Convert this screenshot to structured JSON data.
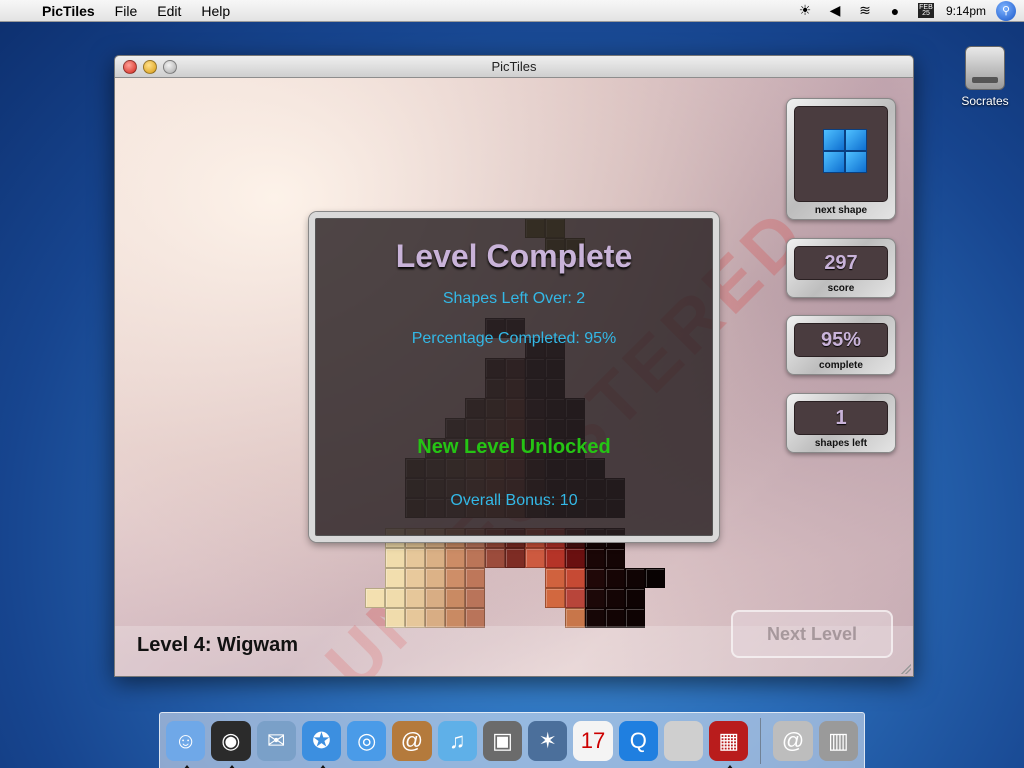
{
  "menubar": {
    "app_name": "PicTiles",
    "menus": [
      "File",
      "Edit",
      "Help"
    ],
    "calendar_month": "FEB",
    "calendar_day": "25",
    "clock": "9:14pm"
  },
  "desktop": {
    "drive_label": "Socrates"
  },
  "window": {
    "title": "PicTiles"
  },
  "dialog": {
    "title": "Level Complete",
    "shapes_left_over": "Shapes Left Over: 2",
    "percentage_completed": "Percentage Completed: 95%",
    "unlocked": "New Level Unlocked",
    "overall_bonus": "Overall Bonus: 10"
  },
  "panels": {
    "next_shape_caption": "next shape",
    "score_value": "297",
    "score_caption": "score",
    "complete_value": "95%",
    "complete_caption": "complete",
    "shapes_left_value": "1",
    "shapes_left_caption": "shapes left"
  },
  "level": {
    "label": "Level 4: Wigwam"
  },
  "buttons": {
    "next_level": "Next Level"
  },
  "watermark": "UNREGISTERED",
  "colors": {
    "dialog_title": "#c9b3d9",
    "dialog_info": "#33b8e6",
    "dialog_unlock": "#25c414",
    "cube": "#1e8fe8"
  },
  "icons": {
    "menu_apple": "apple-icon",
    "brightness": "brightness-icon",
    "volume": "volume-icon",
    "wifi": "wifi-icon",
    "user": "user-icon",
    "spotlight": "spotlight-icon"
  },
  "dock": [
    {
      "name": "finder-icon",
      "glyph": "☺",
      "bg": "#6fa8e8",
      "running": true
    },
    {
      "name": "dashboard-icon",
      "glyph": "◉",
      "bg": "#2b2b2b",
      "running": true
    },
    {
      "name": "mail-icon",
      "glyph": "✉",
      "bg": "#7aa0c8",
      "running": false
    },
    {
      "name": "safari-icon",
      "glyph": "✪",
      "bg": "#3c8fe0",
      "running": true
    },
    {
      "name": "ichat-icon",
      "glyph": "◎",
      "bg": "#4a9be8",
      "running": false
    },
    {
      "name": "address-book-icon",
      "glyph": "@",
      "bg": "#b47a3c",
      "running": false
    },
    {
      "name": "itunes-icon",
      "glyph": "♫",
      "bg": "#5fb0e8",
      "running": false
    },
    {
      "name": "iphoto-icon",
      "glyph": "▣",
      "bg": "#6b6b6b",
      "running": false
    },
    {
      "name": "imovie-icon",
      "glyph": "✶",
      "bg": "#4b6f9b",
      "running": false
    },
    {
      "name": "ical-icon",
      "glyph": "17",
      "bg": "#f4f4f4",
      "running": false
    },
    {
      "name": "quicktime-icon",
      "glyph": "Q",
      "bg": "#1f7fe0",
      "running": false
    },
    {
      "name": "bootcamp-icon",
      "glyph": "",
      "bg": "#cfcfcf",
      "running": false
    },
    {
      "name": "pictiles-icon",
      "glyph": "▦",
      "bg": "#b91c1c",
      "running": true
    },
    {
      "name": "sep",
      "glyph": "",
      "bg": "",
      "running": false
    },
    {
      "name": "network-icon",
      "glyph": "@",
      "bg": "#bdbdbd",
      "running": false
    },
    {
      "name": "trash-icon",
      "glyph": "▥",
      "bg": "#9a9a9a",
      "running": false
    }
  ]
}
